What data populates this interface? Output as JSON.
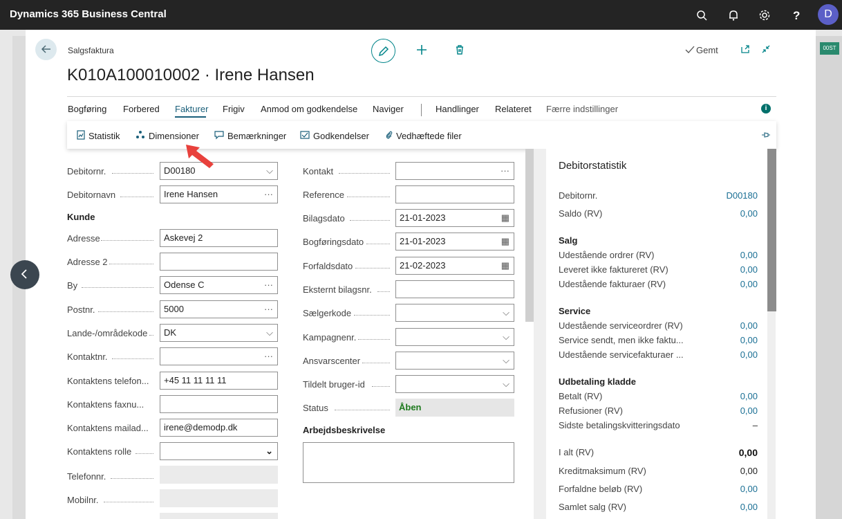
{
  "app": {
    "title": "Dynamics 365 Business Central",
    "user_initial": "D"
  },
  "side_tag": "00ST",
  "breadcrumb": "Salgsfaktura",
  "page_title": "K010A100010002 · Irene Hansen",
  "saved_label": "Gemt",
  "menu": {
    "items": [
      "Bogføring",
      "Forbered",
      "Fakturer",
      "Frigiv",
      "Anmod om godkendelse",
      "Naviger",
      "Handlinger",
      "Relateret",
      "Færre indstillinger"
    ],
    "active": "Fakturer"
  },
  "subbar": {
    "items": [
      "Statistik",
      "Dimensioner",
      "Bemærkninger",
      "Godkendelser",
      "Vedhæftede filer"
    ]
  },
  "form_left": {
    "debitornr": {
      "label": "Debitornr.",
      "value": "D00180"
    },
    "debitornavn": {
      "label": "Debitornavn",
      "value": "Irene Hansen"
    },
    "kunde_group": "Kunde",
    "adresse": {
      "label": "Adresse",
      "value": "Askevej 2"
    },
    "adresse2": {
      "label": "Adresse 2",
      "value": ""
    },
    "by": {
      "label": "By",
      "value": "Odense C"
    },
    "postnr": {
      "label": "Postnr.",
      "value": "5000"
    },
    "landekode": {
      "label": "Lande-/områdekode",
      "value": "DK"
    },
    "kontaktnr": {
      "label": "Kontaktnr.",
      "value": ""
    },
    "kontakt_telefon": {
      "label": "Kontaktens telefon...",
      "value": "+45 11 11 11 11"
    },
    "kontakt_fax": {
      "label": "Kontaktens faxnu...",
      "value": ""
    },
    "kontakt_mail": {
      "label": "Kontaktens mailad...",
      "value": "irene@demodp.dk"
    },
    "kontakt_rolle": {
      "label": "Kontaktens rolle",
      "value": ""
    },
    "telefonnr": {
      "label": "Telefonnr.",
      "value": ""
    },
    "mobilnr": {
      "label": "Mobilnr.",
      "value": ""
    }
  },
  "form_right": {
    "kontakt": {
      "label": "Kontakt",
      "value": ""
    },
    "reference": {
      "label": "Reference",
      "value": ""
    },
    "bilagsdato": {
      "label": "Bilagsdato",
      "value": "21-01-2023"
    },
    "bogforingsdato": {
      "label": "Bogføringsdato",
      "value": "21-01-2023"
    },
    "forfaldsdato": {
      "label": "Forfaldsdato",
      "value": "21-02-2023"
    },
    "eksternt": {
      "label": "Eksternt bilagsnr.",
      "value": ""
    },
    "saelgerkode": {
      "label": "Sælgerkode",
      "value": ""
    },
    "kampagnenr": {
      "label": "Kampagnenr.",
      "value": ""
    },
    "ansvarscenter": {
      "label": "Ansvarscenter",
      "value": ""
    },
    "tildelt": {
      "label": "Tildelt bruger-id",
      "value": ""
    },
    "status": {
      "label": "Status",
      "value": "Åben"
    },
    "arbejdsbeskrivelse": "Arbejdsbeskrivelse"
  },
  "factbox": {
    "title": "Debitorstatistik",
    "debitornr": {
      "label": "Debitornr.",
      "value": "D00180"
    },
    "saldo": {
      "label": "Saldo (RV)",
      "value": "0,00"
    },
    "salg_group": "Salg",
    "udest_ordrer": {
      "label": "Udestående ordrer (RV)",
      "value": "0,00"
    },
    "leveret": {
      "label": "Leveret ikke faktureret (RV)",
      "value": "0,00"
    },
    "udest_fakt": {
      "label": "Udestående fakturaer (RV)",
      "value": "0,00"
    },
    "service_group": "Service",
    "udest_service": {
      "label": "Udestående serviceordrer (RV)",
      "value": "0,00"
    },
    "service_sendt": {
      "label": "Service sendt, men ikke faktu...",
      "value": "0,00"
    },
    "udest_servicefakt": {
      "label": "Udestående servicefakturaer ...",
      "value": "0,00"
    },
    "udbetaling_group": "Udbetaling kladde",
    "betalt": {
      "label": "Betalt (RV)",
      "value": "0,00"
    },
    "refusioner": {
      "label": "Refusioner (RV)",
      "value": "0,00"
    },
    "sidste": {
      "label": "Sidste betalingskvitteringsdato",
      "value": "–"
    },
    "i_alt": {
      "label": "I alt (RV)",
      "value": "0,00"
    },
    "kreditmaks": {
      "label": "Kreditmaksimum (RV)",
      "value": "0,00"
    },
    "forfaldne": {
      "label": "Forfaldne beløb (RV)",
      "value": "0,00"
    },
    "samlet_salg": {
      "label": "Samlet salg (RV)",
      "value": "0,00"
    }
  },
  "colors": {
    "accent": "#008489",
    "link": "#1a6f94",
    "topbar": "#242424",
    "status_green": "#1e7a1e"
  }
}
